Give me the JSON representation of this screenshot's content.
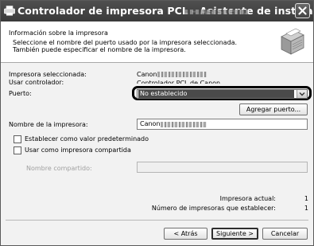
{
  "window": {
    "title": "Controlador de impresora PCL - Asistente de instalación",
    "close_icon": "close-icon"
  },
  "header": {
    "title": "Información sobre la impresora",
    "line1": "Seleccione el nombre del puerto usado por la impresora seleccionada.",
    "line2": "También puede especificar el nombre de la impresora.",
    "icon": "printer-icon"
  },
  "info": {
    "selected_printer_label": "Impresora seleccionada:",
    "selected_printer_value": "Canon",
    "driver_label": "Usar controlador:",
    "driver_value": "Controlador PCL de Canon",
    "port_label": "Puerto:"
  },
  "port": {
    "selected": "No establecido",
    "add_port_button": "Agregar puerto..."
  },
  "printer_name": {
    "label": "Nombre de la impresora:",
    "value": "Canon"
  },
  "options": {
    "set_default": "Establecer como valor predeterminado",
    "set_default_checked": false,
    "shared": "Usar como impresora compartida",
    "shared_checked": false,
    "share_name_label": "Nombre compartido:",
    "share_name_value": ""
  },
  "counts": {
    "current_label": "Impresora actual:",
    "current_value": "1",
    "total_label": "Número de impresoras que establecer:",
    "total_value": "1"
  },
  "footer": {
    "back": "< Atrás",
    "next": "Siguiente >",
    "cancel": "Cancelar"
  }
}
